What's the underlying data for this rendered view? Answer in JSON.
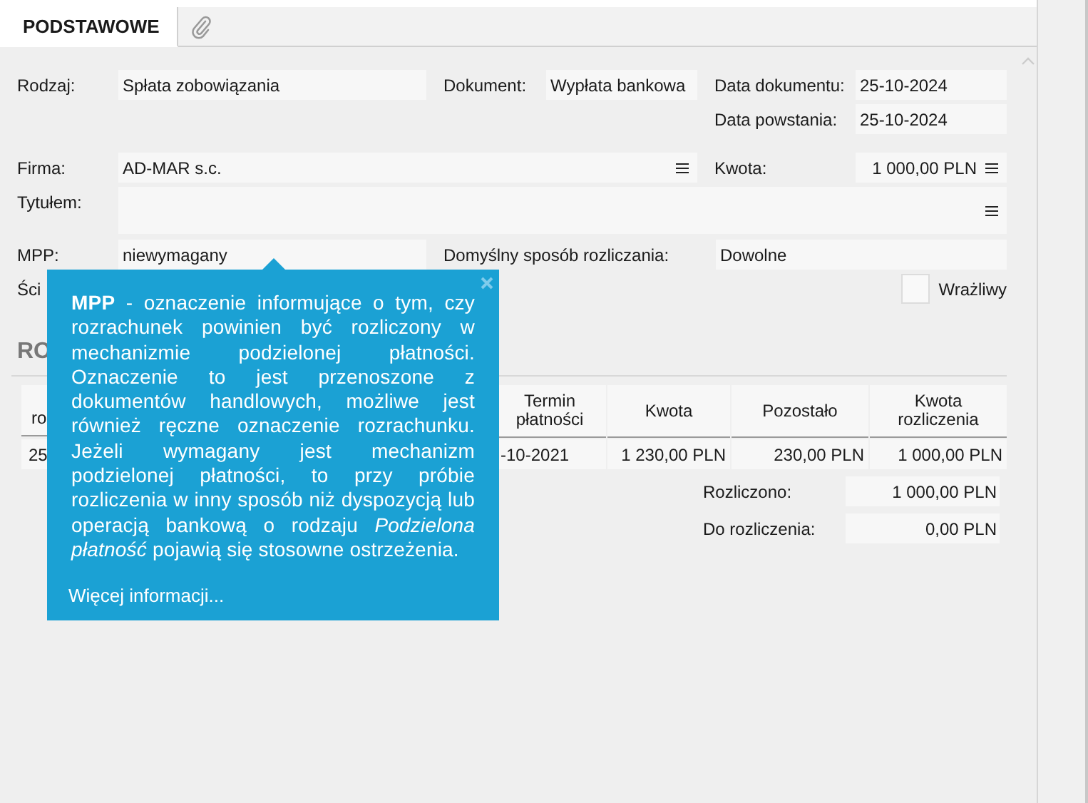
{
  "tabs": [
    {
      "kind": "text",
      "label": "PODSTAWOWE",
      "selected": true
    },
    {
      "kind": "attachments",
      "selected": false
    }
  ],
  "rodzaj": {
    "label": "Rodzaj:",
    "value": "Spłata zobowiązania"
  },
  "dokument": {
    "label": "Dokument:",
    "value": "Wypłata bankowa"
  },
  "data_dokumentu": {
    "label": "Data dokumentu:",
    "value": "25-10-2024"
  },
  "data_powstania": {
    "label": "Data powstania:",
    "value": "25-10-2024"
  },
  "firma": {
    "label": "Firma:",
    "value": "AD-MAR s.c."
  },
  "kwota": {
    "label": "Kwota:",
    "value": "1 000,00 PLN"
  },
  "tytulem": {
    "label": "Tytułem:"
  },
  "mpp": {
    "label": "MPP:",
    "value": "niewymagany"
  },
  "sposob": {
    "label": "Domyślny sposób rozliczania:",
    "value": "Dowolne"
  },
  "row6_label": "Ści",
  "wrazliwy": {
    "label": "Wrażliwy",
    "checked": false
  },
  "section_title": "RO",
  "table": {
    "columns": [
      "ro",
      "Termin płatności",
      "Kwota",
      "Pozostało",
      "Kwota rozliczenia"
    ],
    "rows": [
      [
        "25",
        "-10-2021",
        "1 230,00 PLN",
        "230,00 PLN",
        "1 000,00 PLN"
      ]
    ]
  },
  "summary": [
    {
      "label": "Rozliczono:",
      "value": "1 000,00 PLN"
    },
    {
      "label": "Do rozliczenia:",
      "value": "0,00 PLN"
    }
  ],
  "tooltip": {
    "text": "**MPP** - oznaczenie informujące o tym, czy rozrachunek powinien być rozliczony w mechanizmie podzielonej płatności. Oznaczenie to jest przenoszone z dokumentów handlowych, możliwe jest również ręczne oznaczenie rozrachunku. Jeżeli wymagany jest mechanizm podzielonej płatności, to przy próbie rozliczenia w inny sposób niż dyspozycją lub operacją bankową o rodzaju *Podzielona płatność* pojawią się stosowne ostrzeżenia.",
    "link": "Więcej informacji..."
  }
}
